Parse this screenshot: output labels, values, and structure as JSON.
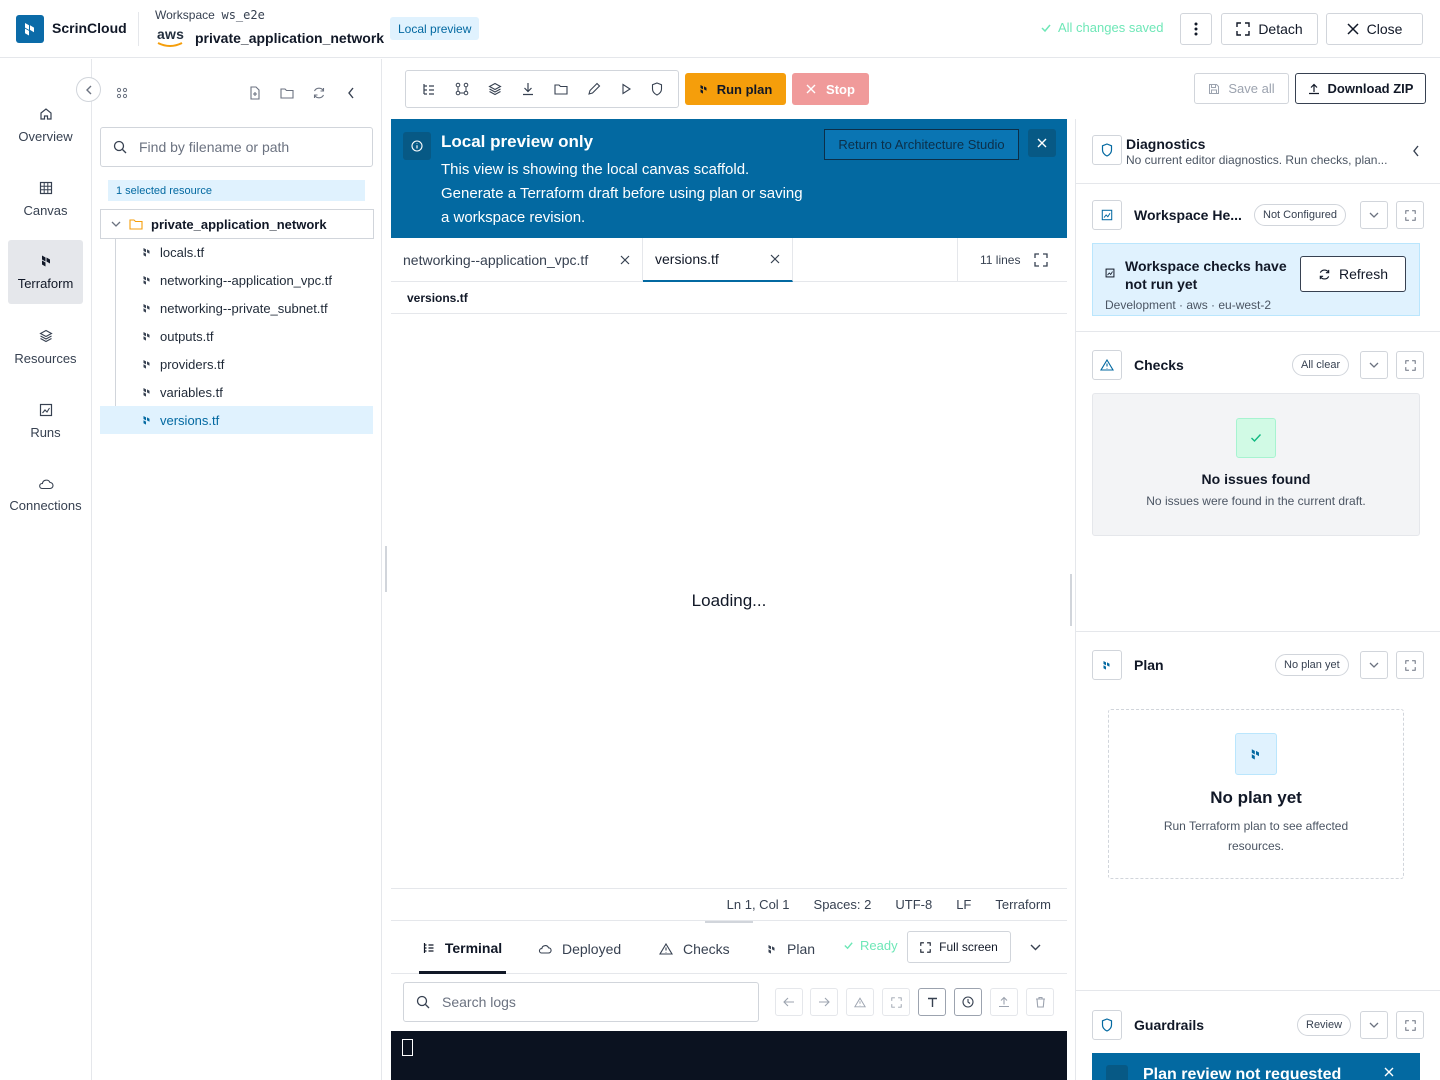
{
  "header": {
    "brand": "ScrinCloud",
    "workspace_label": "Workspace",
    "workspace_id": "ws_e2e",
    "cloud": "aws",
    "project_name": "private_application_network",
    "mode_badge": "Local preview",
    "save_status": "All changes saved",
    "detach_label": "Detach",
    "close_label": "Close"
  },
  "nav": {
    "items": [
      {
        "label": "Overview",
        "icon": "home-icon"
      },
      {
        "label": "Canvas",
        "icon": "grid-icon"
      },
      {
        "label": "Terraform",
        "icon": "terraform-icon",
        "active": true
      },
      {
        "label": "Resources",
        "icon": "layers-icon"
      },
      {
        "label": "Runs",
        "icon": "chart-icon"
      },
      {
        "label": "Connections",
        "icon": "cloud-icon"
      }
    ]
  },
  "files": {
    "search_placeholder": "Find by filename or path",
    "selected_badge": "1 selected resource",
    "folder": "private_application_network",
    "items": [
      "locals.tf",
      "networking--application_vpc.tf",
      "networking--private_subnet.tf",
      "outputs.tf",
      "providers.tf",
      "variables.tf",
      "versions.tf"
    ],
    "active_file": "versions.tf"
  },
  "toolbar": {
    "run_plan": "Run plan",
    "stop": "Stop",
    "save_all": "Save all",
    "download_zip": "Download ZIP"
  },
  "banner": {
    "title": "Local preview only",
    "line1": "This view is showing the local canvas scaffold.",
    "line2": "Generate a Terraform draft before using plan or saving",
    "line3": "a workspace revision.",
    "return_button": "Return to Architecture Studio"
  },
  "editor": {
    "tabs": [
      "networking--application_vpc.tf",
      "versions.tf"
    ],
    "active_tab": "versions.tf",
    "line_count": "11 lines",
    "breadcrumb": "versions.tf",
    "loading": "Loading...",
    "status": {
      "position": "Ln 1, Col 1",
      "indent": "Spaces: 2",
      "encoding": "UTF-8",
      "eol": "LF",
      "language": "Terraform"
    }
  },
  "bottom": {
    "tabs": [
      "Terminal",
      "Deployed",
      "Checks",
      "Plan"
    ],
    "active_tab": "Terminal",
    "status": "Ready",
    "fullscreen_label": "Full screen",
    "search_placeholder": "Search logs"
  },
  "right": {
    "diagnostics": {
      "title": "Diagnostics",
      "subtitle": "No current editor diagnostics. Run checks, plan..."
    },
    "workspace_health": {
      "title": "Workspace He...",
      "pill": "Not Configured",
      "callout_title_1": "Workspace checks have",
      "callout_title_2": "not run yet",
      "refresh_label": "Refresh",
      "meta": "Development · aws · eu-west-2"
    },
    "checks": {
      "title": "Checks",
      "pill": "All clear",
      "empty_title": "No issues found",
      "empty_text": "No issues were found in the current draft."
    },
    "plan": {
      "title": "Plan",
      "pill": "No plan yet",
      "empty_title": "No plan yet",
      "empty_text_1": "Run Terraform plan to see affected",
      "empty_text_2": "resources."
    },
    "guardrails": {
      "title": "Guardrails",
      "pill": "Review",
      "banner": "Plan review not requested"
    }
  },
  "colors": {
    "brand": "#0b6ba8",
    "banner": "#0369a1",
    "run_plan": "#f59e0b",
    "stop": "#f09a9a",
    "success": "#6ee7b7",
    "terminal_bg": "#0b1220"
  }
}
